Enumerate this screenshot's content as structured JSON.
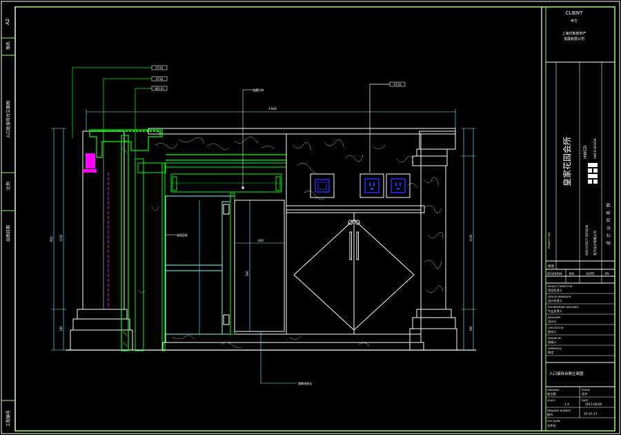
{
  "sheet": {
    "size_code": "A2",
    "left_strip": [
      "图名",
      "入口处接待台立面图",
      "比例",
      "出图日期",
      "工程编号"
    ]
  },
  "title_block": {
    "client_label": "CLIENT",
    "client_label_cn": "甲方",
    "client_name_1": "上海印象房地产",
    "client_name_2": "发展有限公司",
    "project_name": "皇家花园会所",
    "logo_text": "HWCD",
    "logo_sub": "HWCD DESIGN",
    "firm_vertical": "设计公司名称",
    "firm_en": "ARCHITECT DESIGN",
    "firm_cn": "室内设计有限公司",
    "project_no_label": "PROJECT NO.",
    "revision_row_label": "修改",
    "revision_cols": [
      "REVISION",
      "NO.",
      "DATE",
      "BY"
    ],
    "signoffs": [
      {
        "en": "PROJECT DIRECTOR",
        "cn": "项目负责人"
      },
      {
        "en": "DESIGN MANAGER",
        "cn": "设计负责人"
      },
      {
        "en": "ENGINEERING DESIGNER",
        "cn": "专业负责人"
      },
      {
        "en": "DESIGNER",
        "cn": "设计人"
      },
      {
        "en": "CHECKED BY",
        "cn": "校对人"
      },
      {
        "en": "DRAWN BY",
        "cn": "绘图人"
      },
      {
        "en": "APPROVED",
        "cn": "审定"
      }
    ],
    "drawing_title": "入口接待台侧立面图",
    "rows": [
      {
        "a_label": "DRAWING",
        "a_value": "施工图",
        "b_label": "PHASE",
        "b_value": "初步"
      },
      {
        "a_label": "SCALE",
        "a_value": "1:X",
        "b_label": "DATE",
        "b_value": "2011-06-05"
      },
      {
        "a_label": "DRAWING NUMBER",
        "a_value": "图号",
        "b_label": "",
        "b_value": "XT-1F-17"
      },
      {
        "a_label": "FILE NAME",
        "a_value": "文件名",
        "b_label": "",
        "b_value": ""
      }
    ]
  },
  "drawing": {
    "dims": {
      "top": "1400",
      "left_1": "900",
      "left_2": "1150",
      "left_3": "180",
      "right_1": "1100",
      "right_2": "180",
      "mid_h": "800",
      "mid_v": "590"
    },
    "callouts": [
      "ST-01",
      "ST-02",
      "WD-01",
      "ST-03",
      "暗藏灯带",
      "玻璃层板",
      "踢脚线做法"
    ]
  },
  "colors": {
    "frame": "#ffffff",
    "outline": "#ffffff",
    "cyan": "#7fffff",
    "green": "#00ff00",
    "lime": "#9bff5a",
    "yellow": "#ffff00",
    "magenta": "#ff00ff",
    "blue": "#2a2aff"
  }
}
